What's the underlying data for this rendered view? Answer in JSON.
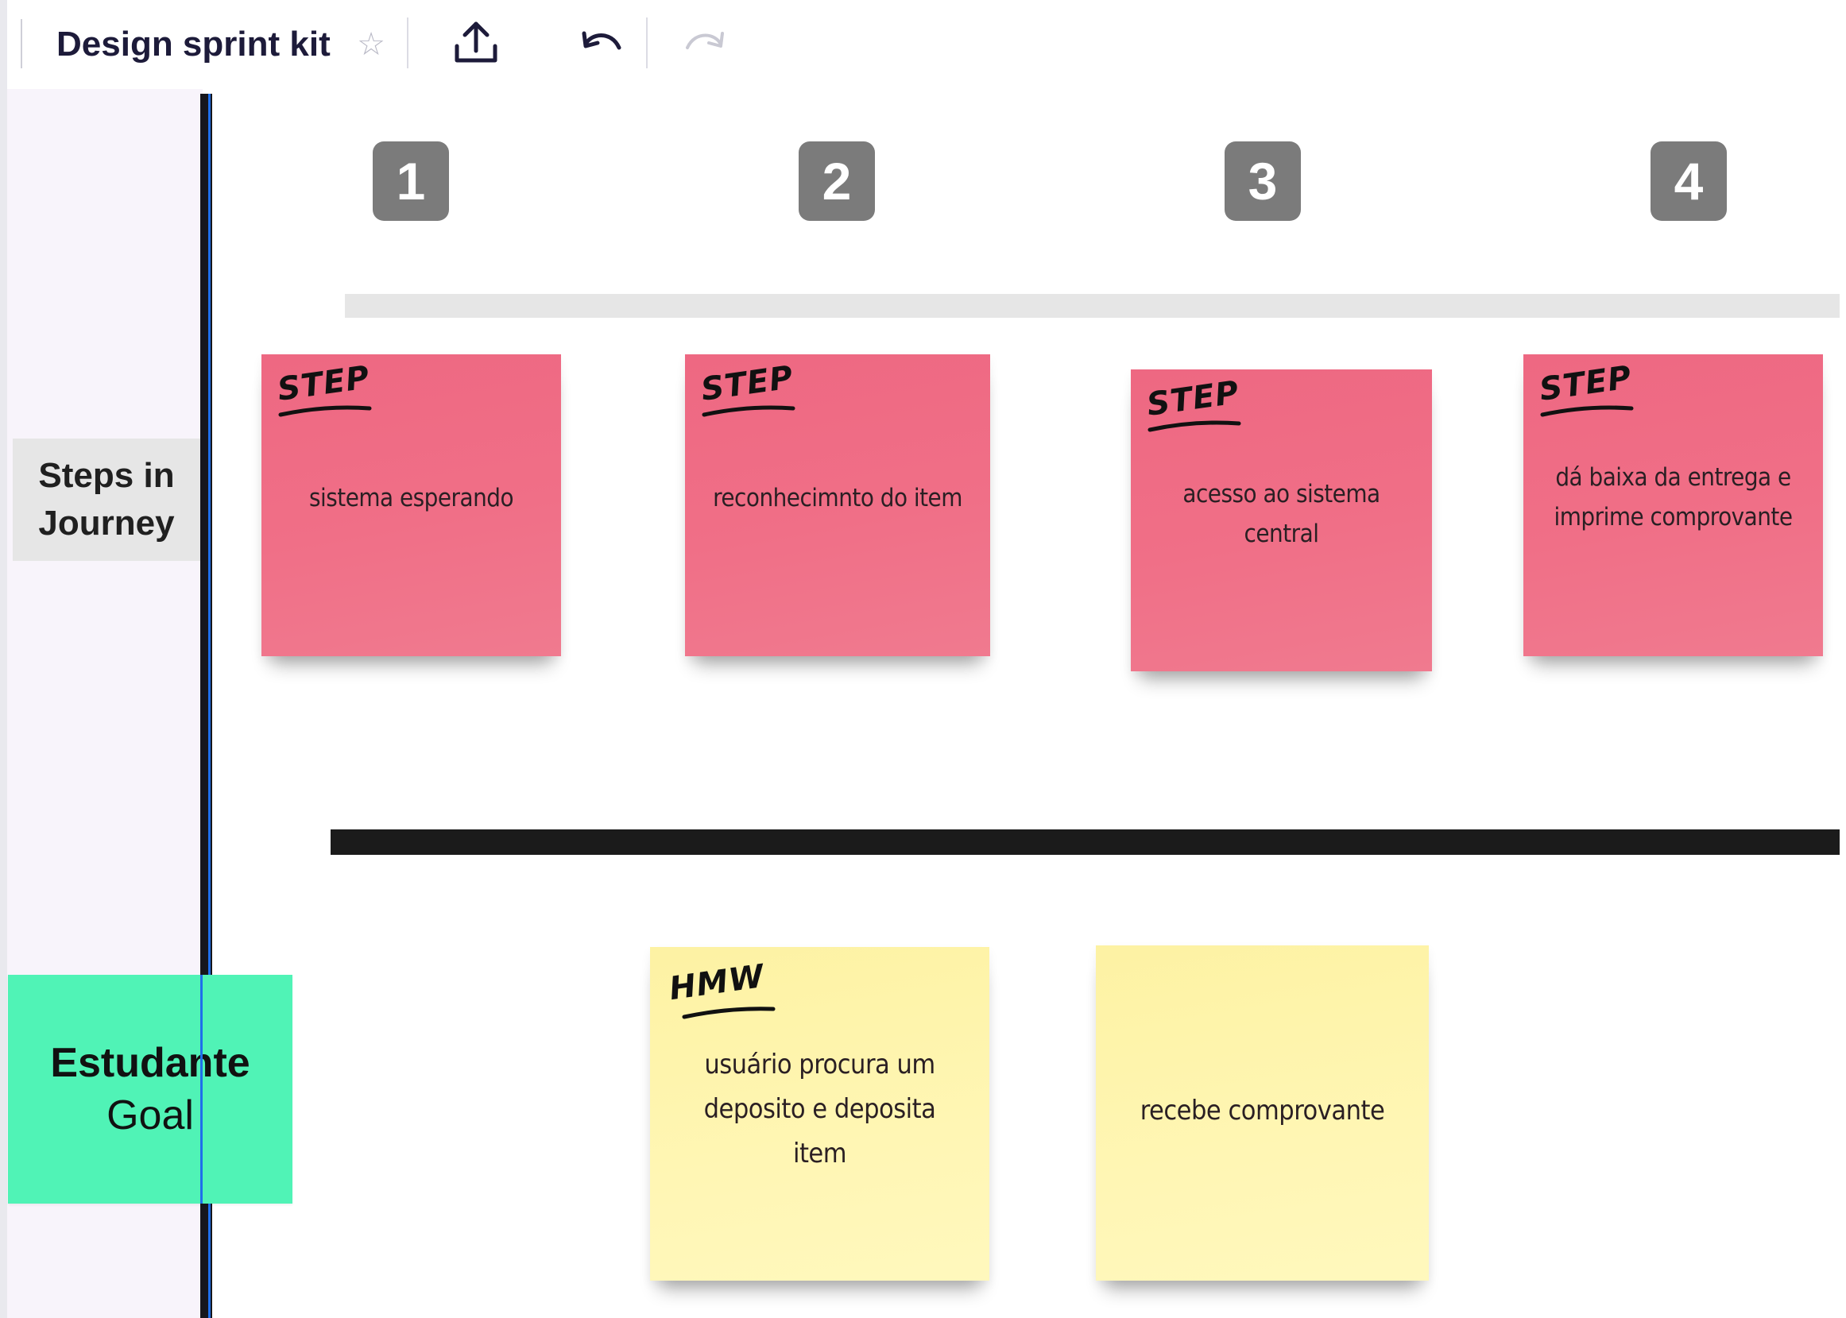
{
  "toolbar": {
    "title": "Design sprint kit",
    "star_icon": "star-icon",
    "export_icon": "upload-export-icon",
    "undo_icon": "undo-icon",
    "redo_icon": "redo-icon"
  },
  "step_numbers": [
    "1",
    "2",
    "3",
    "4"
  ],
  "lanes": {
    "steps": "Steps in Journey",
    "goal_name": "Estudante",
    "goal_sub": "Goal"
  },
  "step_notes": [
    {
      "tag": "STEP",
      "text": "sistema esperando"
    },
    {
      "tag": "STEP",
      "text": "reconhecimnto do item"
    },
    {
      "tag": "STEP",
      "text": "acesso ao sistema central"
    },
    {
      "tag": "STEP",
      "text": "dá baixa da entrega e imprime comprovante"
    }
  ],
  "goal_notes": [
    {
      "tag": "HMW",
      "text": "usuário procura um deposito e deposita item"
    },
    {
      "tag": "",
      "text": "recebe comprovante"
    }
  ],
  "colors": {
    "step_note": "#ef6b84",
    "goal_note": "#fff4ad",
    "goal_card": "#50f3b6",
    "badge": "#7b7b7b"
  }
}
